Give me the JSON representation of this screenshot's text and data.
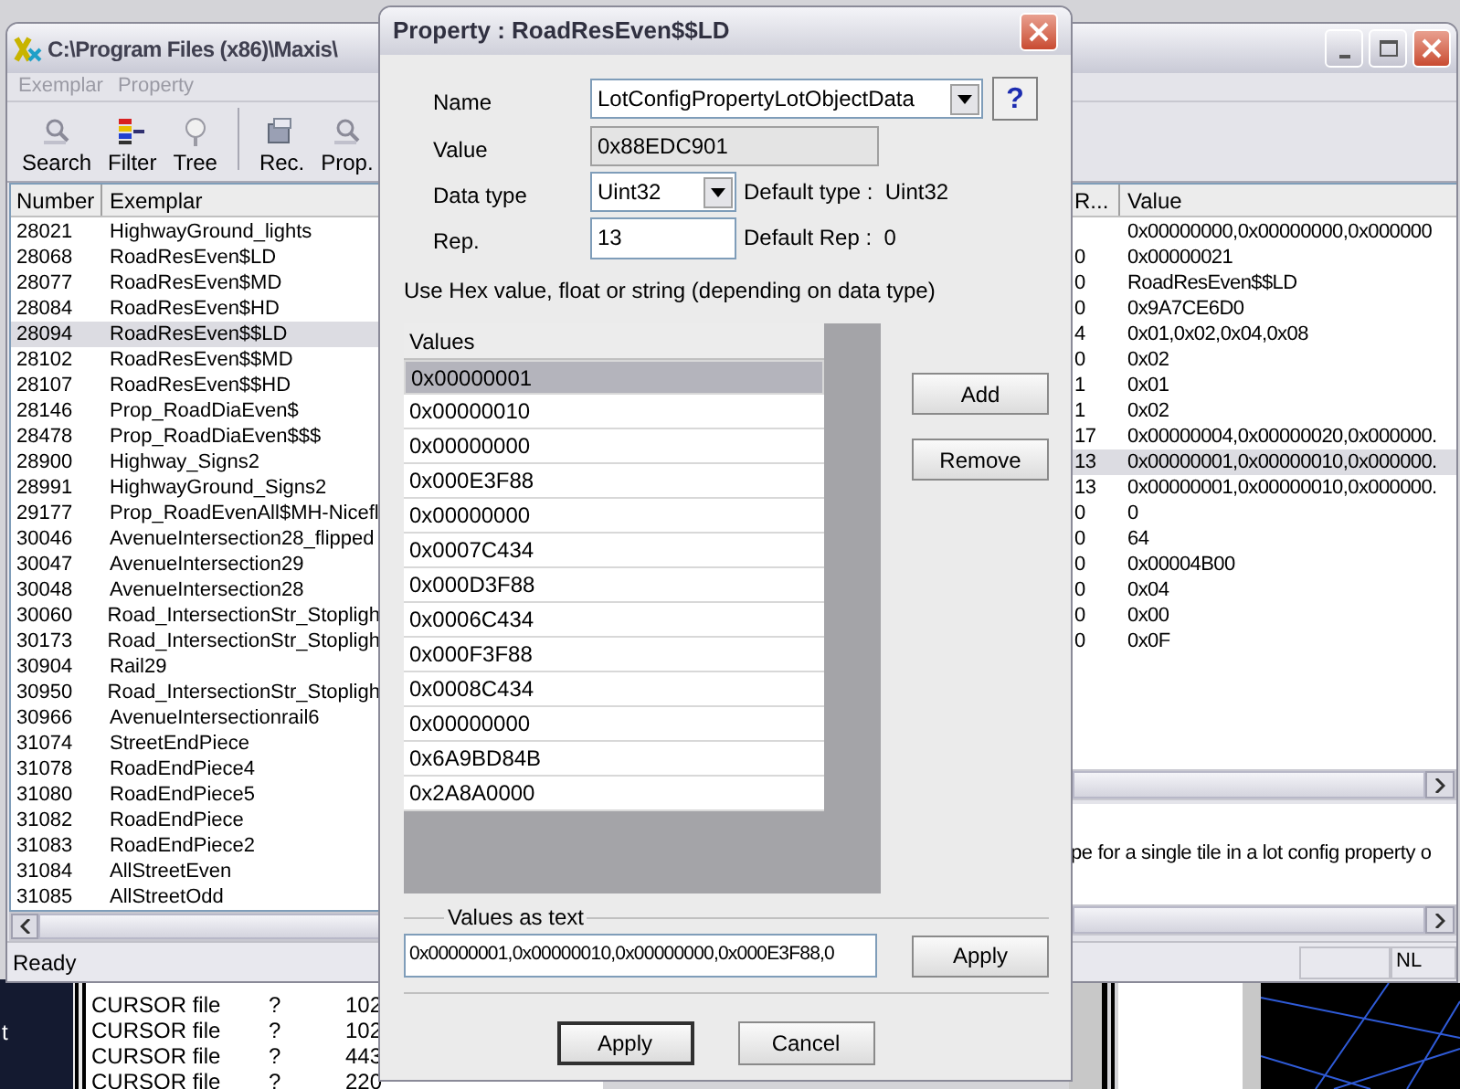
{
  "main_window": {
    "title": "C:\\Program Files (x86)\\Maxis\\",
    "menu": [
      {
        "label": "Exemplar",
        "disabled": true
      },
      {
        "label": "Property",
        "disabled": true
      }
    ],
    "toolbar": [
      {
        "kind": "button",
        "label": "Search"
      },
      {
        "kind": "button",
        "label": "Filter"
      },
      {
        "kind": "button",
        "label": "Tree"
      },
      {
        "kind": "separator"
      },
      {
        "kind": "button",
        "label": "Rec."
      },
      {
        "kind": "button",
        "label": "Prop."
      }
    ],
    "exemplar_list": {
      "columns": [
        "Number",
        "Exemplar"
      ],
      "rows": [
        {
          "number": "28021",
          "exemplar": "HighwayGround_lights",
          "selected": false
        },
        {
          "number": "28068",
          "exemplar": "RoadResEven$LD",
          "selected": false
        },
        {
          "number": "28077",
          "exemplar": "RoadResEven$MD",
          "selected": false
        },
        {
          "number": "28084",
          "exemplar": "RoadResEven$HD",
          "selected": false
        },
        {
          "number": "28094",
          "exemplar": "RoadResEven$$LD",
          "selected": true
        },
        {
          "number": "28102",
          "exemplar": "RoadResEven$$MD",
          "selected": false
        },
        {
          "number": "28107",
          "exemplar": "RoadResEven$$HD",
          "selected": false
        },
        {
          "number": "28146",
          "exemplar": "Prop_RoadDiaEven$",
          "selected": false
        },
        {
          "number": "28478",
          "exemplar": "Prop_RoadDiaEven$$$",
          "selected": false
        },
        {
          "number": "28900",
          "exemplar": "Highway_Signs2",
          "selected": false
        },
        {
          "number": "28991",
          "exemplar": "HighwayGround_Signs2",
          "selected": false
        },
        {
          "number": "29177",
          "exemplar": "Prop_RoadEvenAll$MH-Nicefl",
          "selected": false
        },
        {
          "number": "30046",
          "exemplar": "AvenueIntersection28_flipped",
          "selected": false
        },
        {
          "number": "30047",
          "exemplar": "AvenueIntersection29",
          "selected": false
        },
        {
          "number": "30048",
          "exemplar": "AvenueIntersection28",
          "selected": false
        },
        {
          "number": "30060",
          "exemplar": "Road_IntersectionStr_Stopligh",
          "selected": false
        },
        {
          "number": "30173",
          "exemplar": "Road_IntersectionStr_Stopligh",
          "selected": false
        },
        {
          "number": "30904",
          "exemplar": "Rail29",
          "selected": false
        },
        {
          "number": "30950",
          "exemplar": "Road_IntersectionStr_Stopligh",
          "selected": false
        },
        {
          "number": "30966",
          "exemplar": "AvenueIntersectionrail6",
          "selected": false
        },
        {
          "number": "31074",
          "exemplar": "StreetEndPiece",
          "selected": false
        },
        {
          "number": "31078",
          "exemplar": "RoadEndPiece4",
          "selected": false
        },
        {
          "number": "31080",
          "exemplar": "RoadEndPiece5",
          "selected": false
        },
        {
          "number": "31082",
          "exemplar": "RoadEndPiece",
          "selected": false
        },
        {
          "number": "31083",
          "exemplar": "RoadEndPiece2",
          "selected": false
        },
        {
          "number": "31084",
          "exemplar": "AllStreetEven",
          "selected": false
        },
        {
          "number": "31085",
          "exemplar": "AllStreetOdd",
          "selected": false
        }
      ]
    },
    "property_list": {
      "columns": [
        "R...",
        "Value"
      ],
      "rows": [
        {
          "value": "0x00000000,0x00000000,0x000000",
          "selected": false
        },
        {
          "rep": "0",
          "value": "0x00000021",
          "selected": false
        },
        {
          "rep": "0",
          "value": "RoadResEven$$LD",
          "selected": false
        },
        {
          "rep": "0",
          "value": "0x9A7CE6D0",
          "selected": false
        },
        {
          "rep": "4",
          "value": "0x01,0x02,0x04,0x08",
          "selected": false
        },
        {
          "rep": "0",
          "value": "0x02",
          "selected": false
        },
        {
          "rep": "1",
          "value": "0x01",
          "selected": false
        },
        {
          "rep": "1",
          "value": "0x02",
          "selected": false
        },
        {
          "rep": "17",
          "value": "0x00000004,0x00000020,0x000000.",
          "selected": false
        },
        {
          "rep": "13",
          "value": "0x00000001,0x00000010,0x000000.",
          "selected": true
        },
        {
          "rep": "13",
          "value": "0x00000001,0x00000010,0x000000.",
          "selected": false
        },
        {
          "rep": "0",
          "value": "0",
          "selected": false
        },
        {
          "rep": "0",
          "value": "64",
          "selected": false
        },
        {
          "rep": "0",
          "value": "0x00004B00",
          "selected": false
        },
        {
          "rep": "0",
          "value": "0x04",
          "selected": false
        },
        {
          "rep": "0",
          "value": "0x00",
          "selected": false
        },
        {
          "rep": "0",
          "value": "0x0F",
          "selected": false
        }
      ]
    },
    "description": "pe for a single tile in a lot config property o",
    "status_bar": {
      "text": "Ready",
      "indicator": "NL"
    }
  },
  "dialog": {
    "title": "Property : RoadResEven$$LD",
    "name_label": "Name",
    "name_value": "LotConfigPropertyLotObjectData",
    "help_button": "?",
    "value_label": "Value",
    "value_value": "0x88EDC901",
    "data_type_label": "Data type",
    "data_type_value": "Uint32",
    "default_type": "Default type :  Uint32",
    "rep_label": "Rep.",
    "rep_value": "13",
    "default_rep": "Default Rep :  0",
    "hint": "Use Hex value, float or string (depending on data type)",
    "values_header": "Values",
    "values": [
      {
        "text": "0x00000001",
        "selected": true
      },
      {
        "text": "0x00000010",
        "selected": false
      },
      {
        "text": "0x00000000",
        "selected": false
      },
      {
        "text": "0x000E3F88",
        "selected": false
      },
      {
        "text": "0x00000000",
        "selected": false
      },
      {
        "text": "0x0007C434",
        "selected": false
      },
      {
        "text": "0x000D3F88",
        "selected": false
      },
      {
        "text": "0x0006C434",
        "selected": false
      },
      {
        "text": "0x000F3F88",
        "selected": false
      },
      {
        "text": "0x0008C434",
        "selected": false
      },
      {
        "text": "0x00000000",
        "selected": false
      },
      {
        "text": "0x6A9BD84B",
        "selected": false
      },
      {
        "text": "0x2A8A0000",
        "selected": false
      }
    ],
    "add_button": "Add",
    "remove_button": "Remove",
    "values_as_text_label": "Values as text",
    "values_as_text": "0x00000001,0x00000010,0x00000000,0x000E3F88,0",
    "apply_text_button": "Apply",
    "apply_button": "Apply",
    "cancel_button": "Cancel"
  },
  "background_window": {
    "rows": [
      {
        "name": "CURSOR file",
        "col_2": "?",
        "col_3": "102"
      },
      {
        "name": "CURSOR file",
        "col_2": "?",
        "col_3": "102"
      },
      {
        "name": "CURSOR file",
        "col_2": "?",
        "col_3": "443"
      },
      {
        "name": "CURSOR file",
        "col_2": "?",
        "col_3": "220"
      }
    ]
  },
  "desktop_text": "t"
}
